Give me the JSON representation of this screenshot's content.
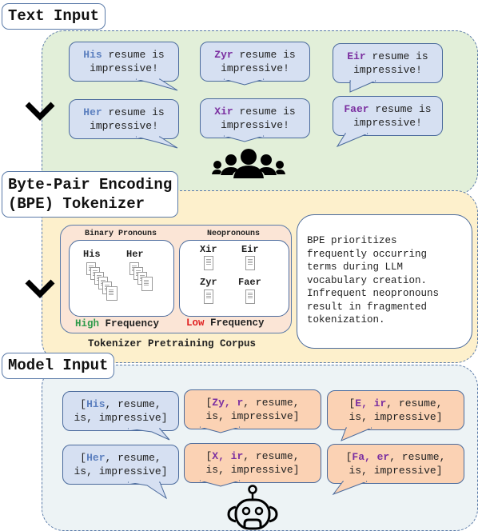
{
  "sections": {
    "text_input": {
      "title": "Text Input"
    },
    "tokenizer": {
      "title_line1": "Byte-Pair Encoding",
      "title_line2": "(BPE) Tokenizer"
    },
    "model_input": {
      "title": "Model Input"
    }
  },
  "text_bubbles": [
    {
      "pronoun": "His",
      "rest": " resume is",
      "line2": "impressive!",
      "color": "blue"
    },
    {
      "pronoun": "Zyr",
      "rest": " resume is",
      "line2": "impressive!",
      "color": "purple"
    },
    {
      "pronoun": "Eir",
      "rest": " resume is",
      "line2": "impressive!",
      "color": "purple"
    },
    {
      "pronoun": "Her",
      "rest": " resume is",
      "line2": "impressive!",
      "color": "blue"
    },
    {
      "pronoun": "Xir",
      "rest": " resume is",
      "line2": "impressive!",
      "color": "purple"
    },
    {
      "pronoun": "Faer",
      "rest": " resume is",
      "line2": "impressive!",
      "color": "purple"
    }
  ],
  "corpus": {
    "binary_label": "Binary Pronouns",
    "neo_label": "Neopronouns",
    "binary_words": [
      "His",
      "Her"
    ],
    "neo_words": [
      "Xir",
      "Eir",
      "Zyr",
      "Faer"
    ],
    "high": "High",
    "low": "Low",
    "frequency": " Frequency",
    "caption": "Tokenizer Pretraining Corpus"
  },
  "note": "BPE prioritizes\nfrequently occurring\nterms during LLM\nvocabulary creation.\nInfrequent neopronouns\nresult in fragmented\ntokenization.",
  "token_bubbles": [
    {
      "open": "[",
      "tokens": "His",
      "rest": ", resume,",
      "line2": "is, impressive]"
    },
    {
      "open": "[",
      "tokens": "Zy, r",
      "rest": ", resume,",
      "line2": "is, impressive]"
    },
    {
      "open": "[",
      "tokens": "E, ir",
      "rest": ", resume,",
      "line2": "is, impressive]"
    },
    {
      "open": "[",
      "tokens": "Her",
      "rest": ", resume,",
      "line2": "is, impressive]"
    },
    {
      "open": "[",
      "tokens": "X, ir",
      "rest": ", resume,",
      "line2": "is, impressive]"
    },
    {
      "open": "[",
      "tokens": "Fa, er",
      "rest": ", resume,",
      "line2": "is, impressive]"
    }
  ],
  "colors": {
    "blue_pronoun": "#5b7fbf",
    "neo_pronoun": "#7b2fa0",
    "high": "#2f9a4a",
    "low": "#e02020"
  }
}
